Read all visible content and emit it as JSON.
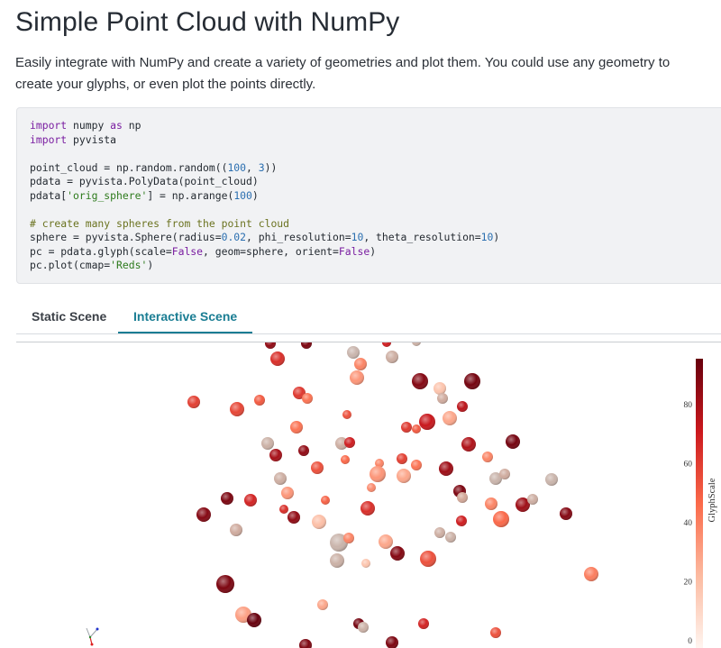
{
  "page": {
    "title": "Simple Point Cloud with NumPy",
    "description": "Easily integrate with NumPy and create a variety of geometries and plot them. You could use any geometry to create your glyphs, or even plot the points directly."
  },
  "code": {
    "lines": [
      [
        [
          "kw",
          "import"
        ],
        [
          "txt",
          " numpy "
        ],
        [
          "kw",
          "as"
        ],
        [
          "txt",
          " np"
        ]
      ],
      [
        [
          "kw",
          "import"
        ],
        [
          "txt",
          " pyvista"
        ]
      ],
      [],
      [
        [
          "txt",
          "point_cloud = np.random.random(("
        ],
        [
          "num",
          "100"
        ],
        [
          "txt",
          ", "
        ],
        [
          "num",
          "3"
        ],
        [
          "txt",
          "))"
        ]
      ],
      [
        [
          "txt",
          "pdata = pyvista.PolyData(point_cloud)"
        ]
      ],
      [
        [
          "txt",
          "pdata["
        ],
        [
          "str",
          "'orig_sphere'"
        ],
        [
          "txt",
          "] = np.arange("
        ],
        [
          "num",
          "100"
        ],
        [
          "txt",
          ")"
        ]
      ],
      [],
      [
        [
          "cmt",
          "# create many spheres from the point cloud"
        ]
      ],
      [
        [
          "txt",
          "sphere = pyvista.Sphere(radius="
        ],
        [
          "num",
          "0.02"
        ],
        [
          "txt",
          ", phi_resolution="
        ],
        [
          "num",
          "10"
        ],
        [
          "txt",
          ", theta_resolution="
        ],
        [
          "num",
          "10"
        ],
        [
          "txt",
          ")"
        ]
      ],
      [
        [
          "txt",
          "pc = pdata.glyph(scale="
        ],
        [
          "kw",
          "False"
        ],
        [
          "txt",
          ", geom=sphere, orient="
        ],
        [
          "kw",
          "False"
        ],
        [
          "txt",
          ")"
        ]
      ],
      [
        [
          "txt",
          "pc.plot(cmap="
        ],
        [
          "str",
          "'Reds'"
        ],
        [
          "txt",
          ")"
        ]
      ]
    ]
  },
  "tabs": [
    {
      "label": "Static Scene",
      "active": false
    },
    {
      "label": "Interactive Scene",
      "active": true
    }
  ],
  "scalar_bar": {
    "title": "GlyphScale",
    "ticks": [
      "0",
      "20",
      "40",
      "60",
      "80"
    ],
    "colormap": [
      "#fff5f0",
      "#fcbba1",
      "#fb6a4a",
      "#cb181d",
      "#67000d"
    ]
  },
  "spheres": [
    [
      215,
      445,
      7,
      60
    ],
    [
      263,
      453,
      8,
      58
    ],
    [
      288,
      443,
      6,
      52
    ],
    [
      308,
      397,
      8,
      65
    ],
    [
      300,
      380,
      6,
      85
    ],
    [
      340,
      380,
      6,
      90
    ],
    [
      332,
      435,
      7,
      62
    ],
    [
      341,
      441,
      6,
      45
    ],
    [
      385,
      459,
      5,
      55
    ],
    [
      392,
      390,
      7,
      5
    ],
    [
      396,
      418,
      8,
      35
    ],
    [
      400,
      403,
      7,
      40
    ],
    [
      429,
      379,
      5,
      70
    ],
    [
      435,
      395,
      7,
      10
    ],
    [
      462,
      378,
      5,
      8
    ],
    [
      466,
      422,
      9,
      88
    ],
    [
      488,
      430,
      7,
      20
    ],
    [
      491,
      441,
      6,
      12
    ],
    [
      524,
      422,
      9,
      92
    ],
    [
      513,
      450,
      6,
      75
    ],
    [
      499,
      463,
      8,
      30
    ],
    [
      474,
      467,
      9,
      72
    ],
    [
      462,
      475,
      5,
      52
    ],
    [
      451,
      473,
      6,
      62
    ],
    [
      297,
      491,
      7,
      8
    ],
    [
      306,
      504,
      7,
      80
    ],
    [
      337,
      499,
      6,
      85
    ],
    [
      329,
      473,
      7,
      45
    ],
    [
      379,
      491,
      7,
      10
    ],
    [
      388,
      490,
      6,
      70
    ],
    [
      352,
      518,
      7,
      55
    ],
    [
      383,
      509,
      5,
      48
    ],
    [
      421,
      513,
      5,
      40
    ],
    [
      419,
      525,
      9,
      35
    ],
    [
      448,
      527,
      8,
      30
    ],
    [
      446,
      508,
      6,
      60
    ],
    [
      462,
      515,
      6,
      45
    ],
    [
      495,
      519,
      8,
      82
    ],
    [
      520,
      492,
      8,
      78
    ],
    [
      541,
      506,
      6,
      40
    ],
    [
      569,
      489,
      8,
      92
    ],
    [
      550,
      530,
      7,
      6
    ],
    [
      560,
      525,
      6,
      12
    ],
    [
      612,
      531,
      7,
      6
    ],
    [
      311,
      530,
      7,
      10
    ],
    [
      319,
      546,
      7,
      35
    ],
    [
      278,
      554,
      7,
      68
    ],
    [
      252,
      552,
      7,
      90
    ],
    [
      226,
      570,
      8,
      88
    ],
    [
      315,
      564,
      5,
      65
    ],
    [
      326,
      573,
      7,
      85
    ],
    [
      354,
      578,
      8,
      22
    ],
    [
      361,
      554,
      5,
      50
    ],
    [
      408,
      563,
      8,
      65
    ],
    [
      412,
      540,
      5,
      38
    ],
    [
      510,
      544,
      7,
      90
    ],
    [
      513,
      551,
      6,
      15
    ],
    [
      545,
      558,
      7,
      40
    ],
    [
      556,
      575,
      9,
      48
    ],
    [
      580,
      559,
      8,
      82
    ],
    [
      591,
      553,
      6,
      10
    ],
    [
      628,
      569,
      7,
      88
    ],
    [
      262,
      587,
      7,
      12
    ],
    [
      376,
      601,
      10,
      6
    ],
    [
      387,
      596,
      6,
      40
    ],
    [
      428,
      600,
      8,
      30
    ],
    [
      441,
      613,
      8,
      88
    ],
    [
      475,
      619,
      9,
      55
    ],
    [
      488,
      590,
      6,
      10
    ],
    [
      500,
      595,
      6,
      8
    ],
    [
      512,
      577,
      6,
      70
    ],
    [
      374,
      621,
      8,
      8
    ],
    [
      406,
      624,
      5,
      20
    ],
    [
      656,
      636,
      8,
      42
    ],
    [
      250,
      647,
      10,
      90
    ],
    [
      270,
      681,
      9,
      32
    ],
    [
      282,
      687,
      8,
      95
    ],
    [
      358,
      670,
      6,
      30
    ],
    [
      398,
      691,
      6,
      92
    ],
    [
      403,
      695,
      6,
      8
    ],
    [
      470,
      691,
      6,
      68
    ],
    [
      550,
      701,
      6,
      55
    ],
    [
      435,
      712,
      7,
      90
    ],
    [
      339,
      715,
      7,
      90
    ]
  ]
}
